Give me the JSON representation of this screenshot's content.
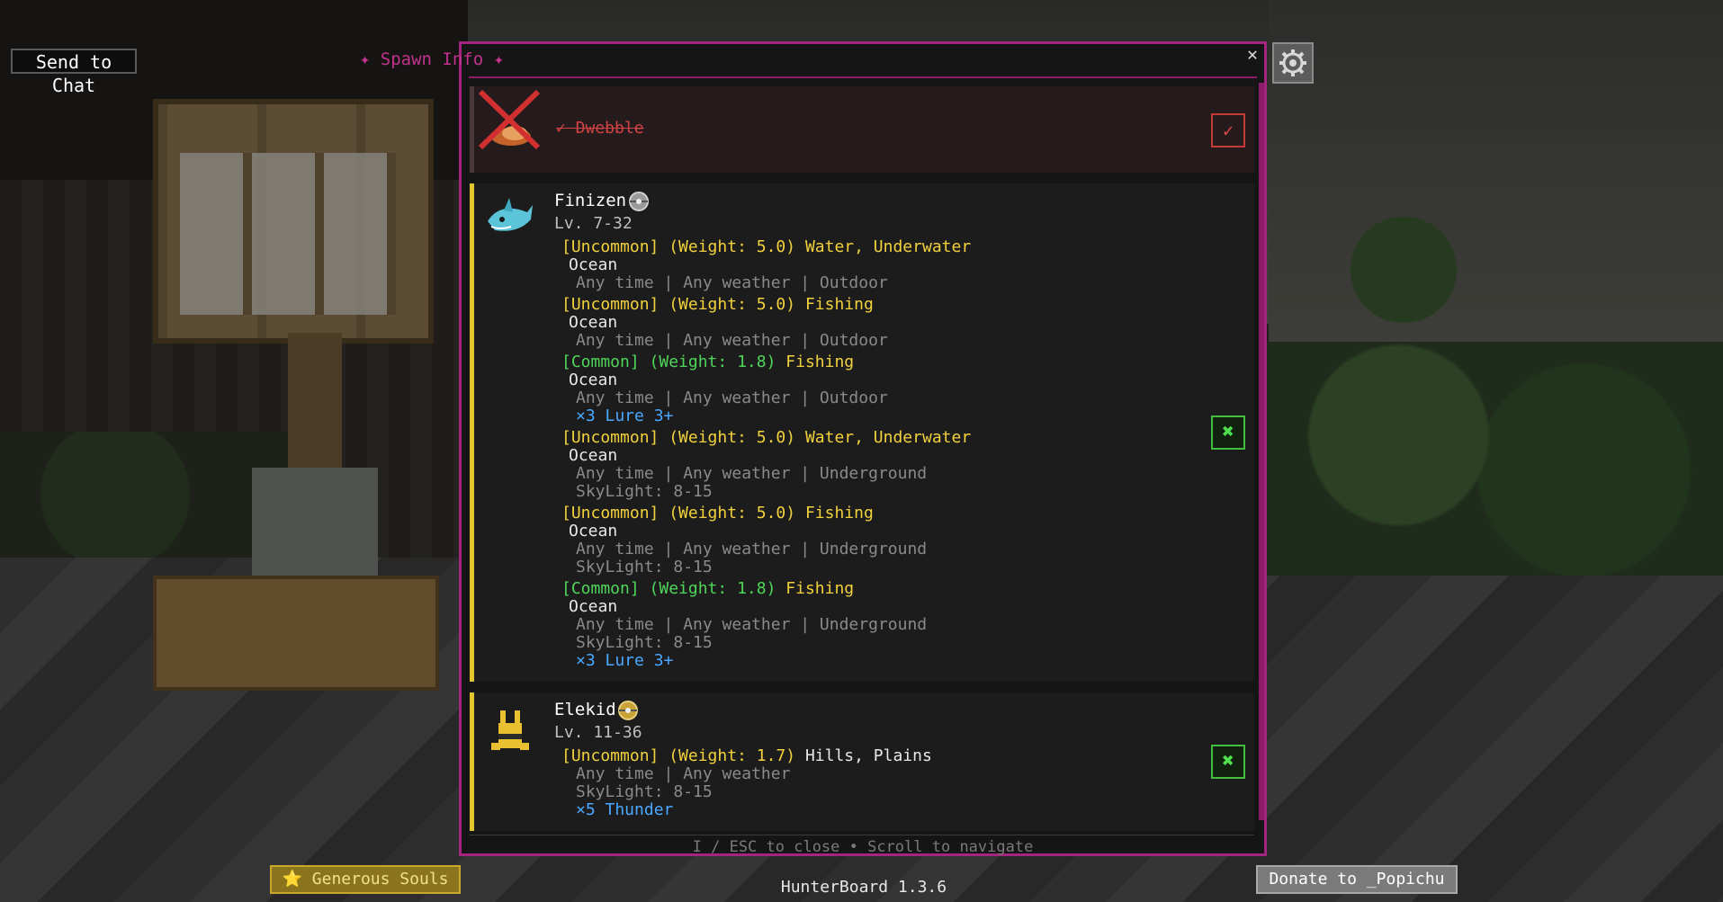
{
  "header": {
    "send_to_chat": "Send to Chat",
    "title": "Spawn Info",
    "star": "✦",
    "close": "✕"
  },
  "caught_entry": {
    "name": "✓ Dwebble",
    "check": "✓"
  },
  "finizen": {
    "name": "Finizen",
    "level": "Lv. 7-32",
    "toggle": "✖",
    "lines": [
      {
        "rarity": "[Uncommon] (Weight: 5.0)",
        "context": "Water, Underwater"
      },
      {
        "text": "Ocean"
      },
      {
        "text": "Any time | Any weather | Outdoor"
      },
      {
        "rarity": "[Uncommon] (Weight: 5.0)",
        "context": "Fishing"
      },
      {
        "text": "Ocean"
      },
      {
        "text": "Any time | Any weather | Outdoor"
      },
      {
        "rarity": "[Common] (Weight: 1.8)",
        "context": "Fishing"
      },
      {
        "text": "Ocean"
      },
      {
        "text": "Any time | Any weather | Outdoor"
      },
      {
        "text": "×3 Lure 3+"
      },
      {
        "rarity": "[Uncommon] (Weight: 5.0)",
        "context": "Water, Underwater"
      },
      {
        "text": "Ocean"
      },
      {
        "text": "Any time | Any weather | Underground"
      },
      {
        "text": "SkyLight: 8-15"
      },
      {
        "rarity": "[Uncommon] (Weight: 5.0)",
        "context": "Fishing"
      },
      {
        "text": "Ocean"
      },
      {
        "text": "Any time | Any weather | Underground"
      },
      {
        "text": "SkyLight: 8-15"
      },
      {
        "rarity": "[Common] (Weight: 1.8)",
        "context": "Fishing"
      },
      {
        "text": "Ocean"
      },
      {
        "text": "Any time | Any weather | Underground"
      },
      {
        "text": "SkyLight: 8-15"
      },
      {
        "text": "×3 Lure 3+"
      }
    ]
  },
  "elekid": {
    "name": "Elekid",
    "level": "Lv. 11-36",
    "toggle": "✖",
    "lines": [
      {
        "rarity": "[Uncommon] (Weight: 1.7)",
        "context": "Hills, Plains"
      },
      {
        "text": "Any time | Any weather"
      },
      {
        "text": "SkyLight: 8-15"
      },
      {
        "text": "×5 Thunder"
      }
    ]
  },
  "footer": "I / ESC to close  •  Scroll to navigate",
  "bottom": {
    "generous": "⭐ Generous Souls",
    "version": "HunterBoard 1.3.6",
    "donate": "Donate to _Popichu"
  }
}
